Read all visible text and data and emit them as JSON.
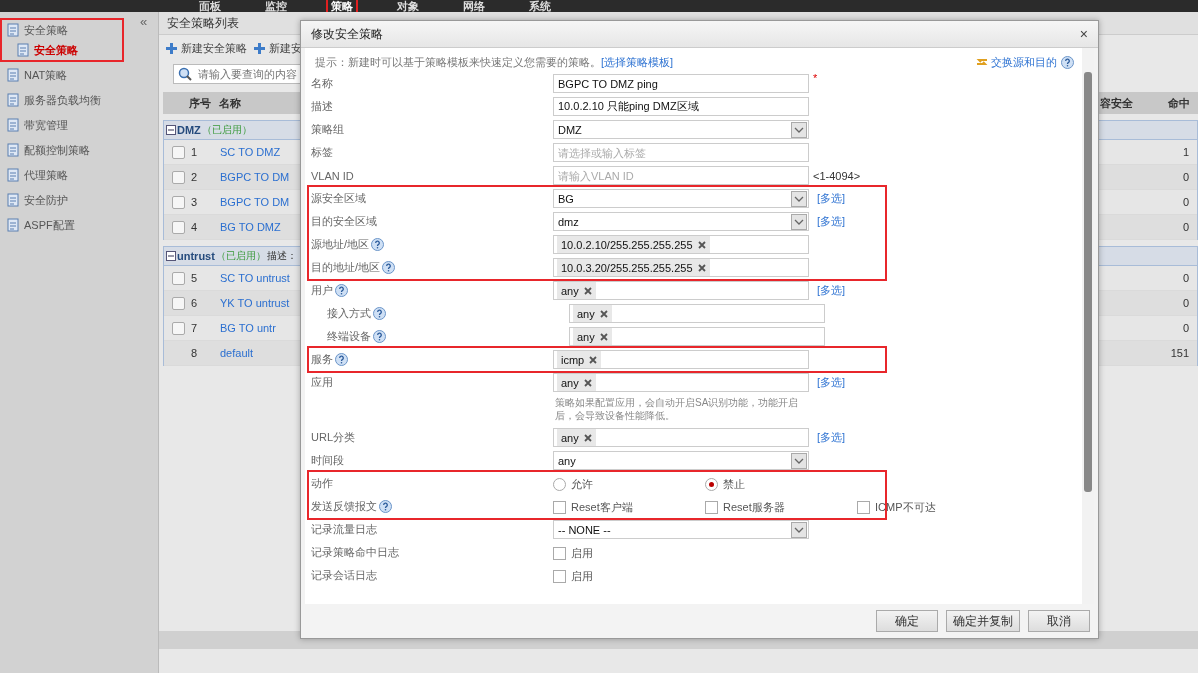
{
  "top_nav": [
    {
      "label": "面板",
      "selected": false,
      "highlighted": false
    },
    {
      "label": "监控",
      "selected": false,
      "highlighted": false
    },
    {
      "label": "策略",
      "selected": true,
      "highlighted": true
    },
    {
      "label": "对象",
      "selected": false,
      "highlighted": false
    },
    {
      "label": "网络",
      "selected": false,
      "highlighted": false
    },
    {
      "label": "系统",
      "selected": false,
      "highlighted": false
    }
  ],
  "sidebar": {
    "collapse": "«",
    "items": [
      {
        "label": "安全策略",
        "expanded": true,
        "highlighted": true,
        "selected": false,
        "children": [
          {
            "label": "安全策略",
            "selected": true
          }
        ]
      },
      {
        "label": "NAT策略",
        "selected": false
      },
      {
        "label": "服务器负载均衡",
        "selected": false
      },
      {
        "label": "带宽管理",
        "selected": false
      },
      {
        "label": "配额控制策略",
        "selected": false
      },
      {
        "label": "代理策略",
        "selected": false
      },
      {
        "label": "安全防护",
        "selected": false
      },
      {
        "label": "ASPF配置",
        "selected": false
      }
    ]
  },
  "list_panel": {
    "title": "安全策略列表",
    "toolbar": [
      "新建安全策略",
      "新建安"
    ],
    "search": {
      "placeholder": "请输入要查询的内容"
    },
    "columns": [
      "序号",
      "名称",
      "容安全",
      "命中"
    ],
    "groups": [
      {
        "name": "DMZ",
        "status": "（已启用）",
        "expanded": true,
        "rows": [
          {
            "no": "1",
            "name": "SC TO DMZ",
            "hits": "1",
            "checked": false
          },
          {
            "no": "2",
            "name": "BGPC TO DM",
            "hits": "0",
            "checked": false
          },
          {
            "no": "3",
            "name": "BGPC TO DM",
            "hits": "0",
            "checked": false
          },
          {
            "no": "4",
            "name": "BG TO DMZ",
            "hits": "0",
            "checked": false
          }
        ]
      },
      {
        "name": "untrust",
        "status": "（已启用）",
        "desc": "描述：",
        "expanded": true,
        "rows": [
          {
            "no": "5",
            "name": "SC TO untrust",
            "hits": "0",
            "checked": false
          },
          {
            "no": "6",
            "name": "YK TO  untrust",
            "hits": "0",
            "checked": false
          },
          {
            "no": "7",
            "name": "BG   TO   untr",
            "hits": "0",
            "checked": false
          },
          {
            "no": "8",
            "name": "default",
            "hits": "151"
          }
        ]
      }
    ]
  },
  "dialog": {
    "title": "修改安全策略",
    "close": "×",
    "hint": {
      "text": "提示：新建时可以基于策略模板来快速定义您需要的策略。",
      "link": "[选择策略模板]"
    },
    "swap_link": "交换源和目的",
    "sections": [
      {
        "rows": [
          {
            "kind": "text",
            "label": "名称",
            "value": "BGPC TO DMZ ping",
            "required_mark": "*"
          },
          {
            "kind": "text",
            "label": "描述",
            "value": "10.0.2.10 只能ping DMZ区域"
          },
          {
            "kind": "select",
            "label": "策略组",
            "value": "DMZ"
          },
          {
            "kind": "text",
            "label": "标签",
            "placeholder": "请选择或输入标签"
          },
          {
            "kind": "text",
            "label": "VLAN ID",
            "placeholder": "请输入VLAN ID",
            "suffix": "<1-4094>"
          }
        ]
      },
      {
        "highlighted": true,
        "rows": [
          {
            "kind": "select",
            "label": "源安全区域",
            "value": "BG",
            "link": "[多选]"
          },
          {
            "kind": "select",
            "label": "目的安全区域",
            "value": "dmz",
            "link": "[多选]"
          },
          {
            "kind": "tags",
            "label": "源地址/地区",
            "help": true,
            "tags": [
              "10.0.2.10/255.255.255.255"
            ]
          },
          {
            "kind": "tags",
            "label": "目的地址/地区",
            "help": true,
            "tags": [
              "10.0.3.20/255.255.255.255"
            ]
          }
        ]
      },
      {
        "rows": [
          {
            "kind": "tags",
            "label": "用户",
            "help": true,
            "tags": [
              "any"
            ],
            "link": "[多选]"
          },
          {
            "kind": "tags",
            "label": "接入方式",
            "help": true,
            "indented": true,
            "tags": [
              "any"
            ]
          },
          {
            "kind": "tags",
            "label": "终端设备",
            "help": true,
            "indented": true,
            "tags": [
              "any"
            ]
          }
        ]
      },
      {
        "highlighted": true,
        "rows": [
          {
            "kind": "tags",
            "label": "服务",
            "help": true,
            "tags": [
              "icmp"
            ]
          }
        ]
      },
      {
        "rows": [
          {
            "kind": "tags",
            "label": "应用",
            "tags": [
              "any"
            ],
            "link": "[多选]",
            "note": "策略如果配置应用，会自动开启SA识别功能，功能开启后，会导致设备性能降低。"
          },
          {
            "kind": "tags",
            "label": "URL分类",
            "tags": [
              "any"
            ],
            "link": "[多选]"
          },
          {
            "kind": "select",
            "label": "时间段",
            "value": "any"
          }
        ]
      },
      {
        "highlighted": true,
        "rows": [
          {
            "kind": "radios",
            "label": "动作",
            "options": [
              {
                "label": "允许",
                "selected": false
              },
              {
                "label": "禁止",
                "selected": true
              }
            ]
          },
          {
            "kind": "checks",
            "label": "发送反馈报文",
            "help": true,
            "options": [
              {
                "label": "Reset客户端",
                "checked": false
              },
              {
                "label": "Reset服务器",
                "checked": false
              },
              {
                "label": "ICMP不可达",
                "checked": false
              }
            ]
          }
        ]
      },
      {
        "rows": [
          {
            "kind": "select",
            "label": "记录流量日志",
            "value": "-- NONE --"
          },
          {
            "kind": "checks",
            "label": "记录策略命中日志",
            "options": [
              {
                "label": "启用",
                "checked": false
              }
            ]
          },
          {
            "kind": "checks",
            "label": "记录会话日志",
            "options": [
              {
                "label": "启用",
                "checked": false
              }
            ]
          }
        ]
      }
    ],
    "buttons": [
      "确定",
      "确定并复制",
      "取消"
    ]
  }
}
